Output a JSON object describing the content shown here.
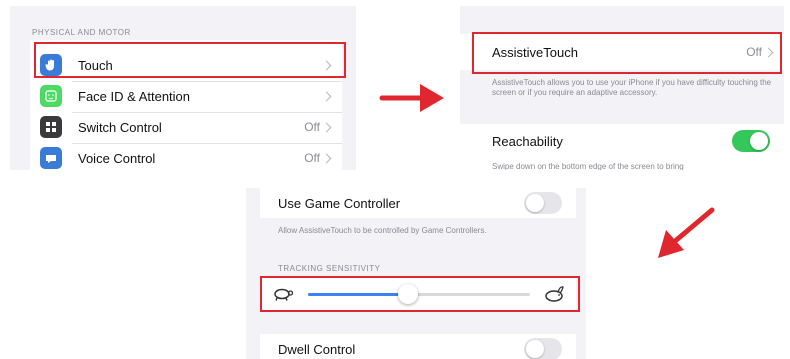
{
  "panel1": {
    "section_header": "PHYSICAL AND MOTOR",
    "items": [
      {
        "label": "Touch",
        "value": "",
        "icon": "hand-icon",
        "color": "#3b7bd8"
      },
      {
        "label": "Face ID & Attention",
        "value": "",
        "icon": "face-id-icon",
        "color": "#4cd964"
      },
      {
        "label": "Switch Control",
        "value": "Off",
        "icon": "switch-control-icon",
        "color": "#3a3a3c"
      },
      {
        "label": "Voice Control",
        "value": "Off",
        "icon": "voice-control-icon",
        "color": "#3b7bd8"
      }
    ]
  },
  "panel2": {
    "assistive_label": "AssistiveTouch",
    "assistive_value": "Off",
    "assistive_note": "AssistiveTouch allows you to use your iPhone if you have difficulty touching the screen or if you require an adaptive accessory.",
    "reachability_label": "Reachability",
    "reachability_on": true,
    "reachability_note": "Swipe down on the bottom edge of the screen to bring"
  },
  "panel3": {
    "game_controller_label": "Use Game Controller",
    "game_controller_on": false,
    "game_controller_note": "Allow AssistiveTouch to be controlled by Game Controllers.",
    "tracking_header": "TRACKING SENSITIVITY",
    "tracking_value": 0.45,
    "slow_icon": "turtle-icon",
    "fast_icon": "rabbit-icon",
    "dwell_label": "Dwell Control",
    "dwell_on": false
  },
  "colors": {
    "highlight": "#e0262e",
    "arrow": "#e0262e",
    "toggle_on": "#34c759",
    "toggle_off": "#e5e5ea"
  }
}
